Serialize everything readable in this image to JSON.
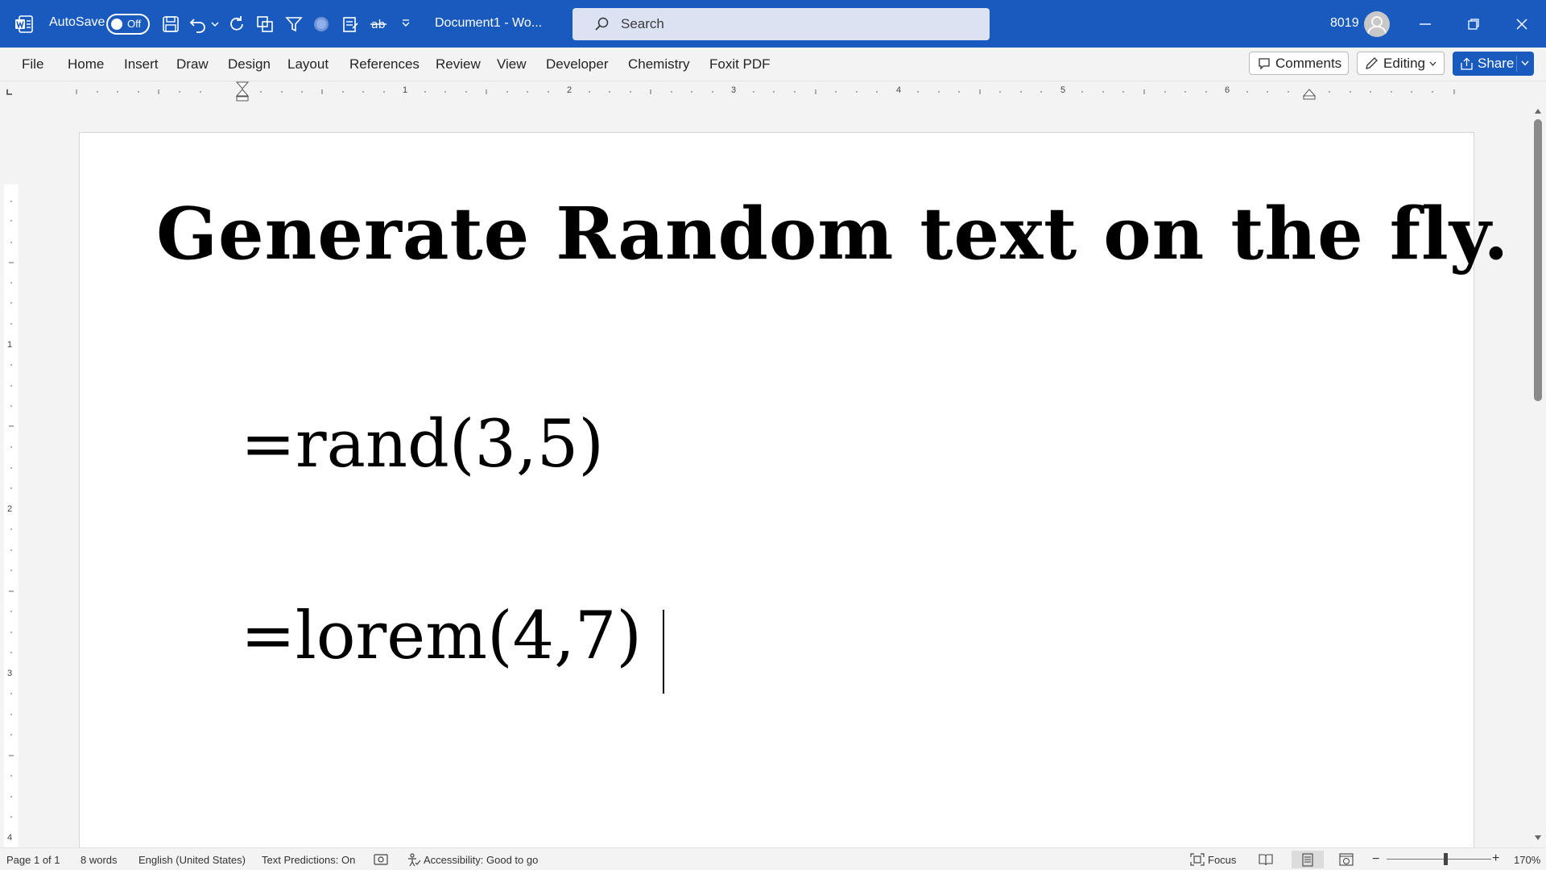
{
  "titlebar": {
    "autosave_label": "AutoSave",
    "autosave_state": "Off",
    "document_title": "Document1  -  Wo...",
    "search_placeholder": "Search",
    "user_name": "8019",
    "accent_color": "#185abd"
  },
  "ribbon": {
    "menu": [
      "File",
      "Home",
      "Insert",
      "Draw",
      "Design",
      "Layout",
      "References",
      "Review",
      "View",
      "Developer",
      "Chemistry",
      "Foxit PDF"
    ],
    "comments_label": "Comments",
    "editing_label": "Editing",
    "share_label": "Share"
  },
  "ruler": {
    "horizontal_numbers": [
      "1",
      "2",
      "3",
      "4",
      "5",
      "6"
    ],
    "vertical_numbers": [
      "1",
      "2",
      "3",
      "4"
    ]
  },
  "document": {
    "heading": "Generate Random text on the fly.",
    "line1": "=rand(3,5)",
    "line2": "=lorem(4,7)"
  },
  "statusbar": {
    "page": "Page 1 of 1",
    "words": "8 words",
    "language": "English (United States)",
    "text_predictions": "Text Predictions: On",
    "accessibility": "Accessibility: Good to go",
    "focus": "Focus",
    "zoom": "170%"
  }
}
